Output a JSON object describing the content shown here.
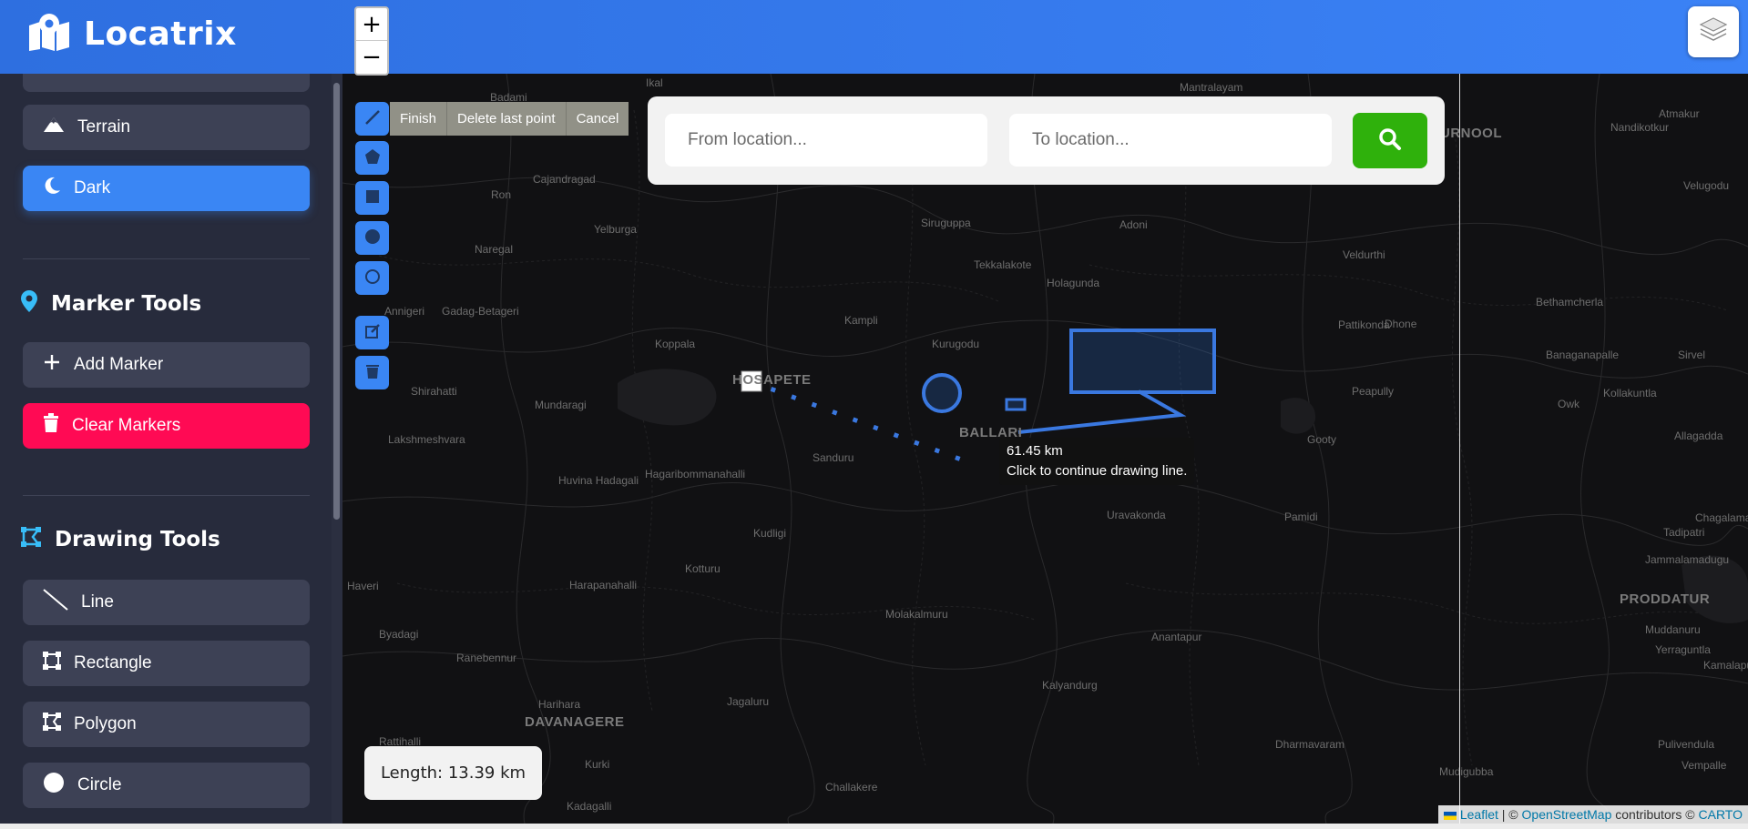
{
  "app": {
    "title": "Locatrix"
  },
  "sidebar": {
    "layer_items": [
      {
        "label": "Terrain",
        "icon": "mountain-icon",
        "active": false
      },
      {
        "label": "Dark",
        "icon": "moon-icon",
        "active": true
      }
    ],
    "marker_tools": {
      "heading": "Marker Tools",
      "add_label": "Add Marker",
      "clear_label": "Clear Markers"
    },
    "drawing_tools": {
      "heading": "Drawing Tools",
      "items": [
        {
          "label": "Line",
          "icon": "line-icon"
        },
        {
          "label": "Rectangle",
          "icon": "rectangle-icon"
        },
        {
          "label": "Polygon",
          "icon": "polygon-icon"
        },
        {
          "label": "Circle",
          "icon": "circle-icon"
        }
      ]
    }
  },
  "map": {
    "zoom_in": "+",
    "zoom_out": "−",
    "draw_actions": {
      "finish": "Finish",
      "delete_last": "Delete last point",
      "cancel": "Cancel"
    },
    "route": {
      "from_placeholder": "From location...",
      "to_placeholder": "To location..."
    },
    "tooltip": {
      "distance": "61.45 km",
      "hint": "Click to continue drawing line."
    },
    "length_label": "Length: 13.39 km",
    "places": [
      "Ikal",
      "Badami",
      "Mantralayam",
      "Atmakur",
      "Nandikotkur",
      "URNOOL",
      "Velugodu",
      "Cajandragad",
      "Ron",
      "Yelburga",
      "Siruguppa",
      "Adoni",
      "Naregal",
      "Tekkalakote",
      "Holagunda",
      "Veldurthi",
      "Annigeri",
      "Gadag-Betageri",
      "Kampli",
      "Kurugodu",
      "Pattikonda",
      "Dhone",
      "Bethamcherla",
      "Koppala",
      "Banaganapalle",
      "Sirvel",
      "Shirahatti",
      "HOSAPETE",
      "Mundaragi",
      "Peapully",
      "Owk",
      "Kollakuntla",
      "BALLARI",
      "Lakshmeshvara",
      "Gooty",
      "Allagadda",
      "Sanduru",
      "Hagaribommanahalli",
      "Huvina Hadagali",
      "Uravakonda",
      "Pamidi",
      "Chagalamarri",
      "Kudligi",
      "Tadipatri",
      "Jammalamadugu",
      "Kotturu",
      "Haveri",
      "Harapanahalli",
      "PRODDATUR",
      "Molakalmuru",
      "Muddanuru",
      "Byadagi",
      "Anantapur",
      "Yerraguntla",
      "Ranebennur",
      "Kamalapuram",
      "Kalyandurg",
      "Harihara",
      "Jagaluru",
      "DAVANAGERE",
      "Rattihalli",
      "Dharmavaram",
      "Pulivendula",
      "Kurki",
      "Mudigubba",
      "Vempalle",
      "Challakere",
      "Kadagalli"
    ]
  },
  "attribution": {
    "leaflet": "Leaflet",
    "sep": "| ©",
    "osm": "OpenStreetMap",
    "contributors": "contributors ©",
    "carto": "CARTO"
  },
  "colors": {
    "header": "#3b82f6",
    "sidebar_bg": "#272b3c",
    "button_bg": "#3d4155",
    "active": "#3a86f4",
    "danger": "#ff0a54",
    "search_green": "#2fb10c"
  }
}
